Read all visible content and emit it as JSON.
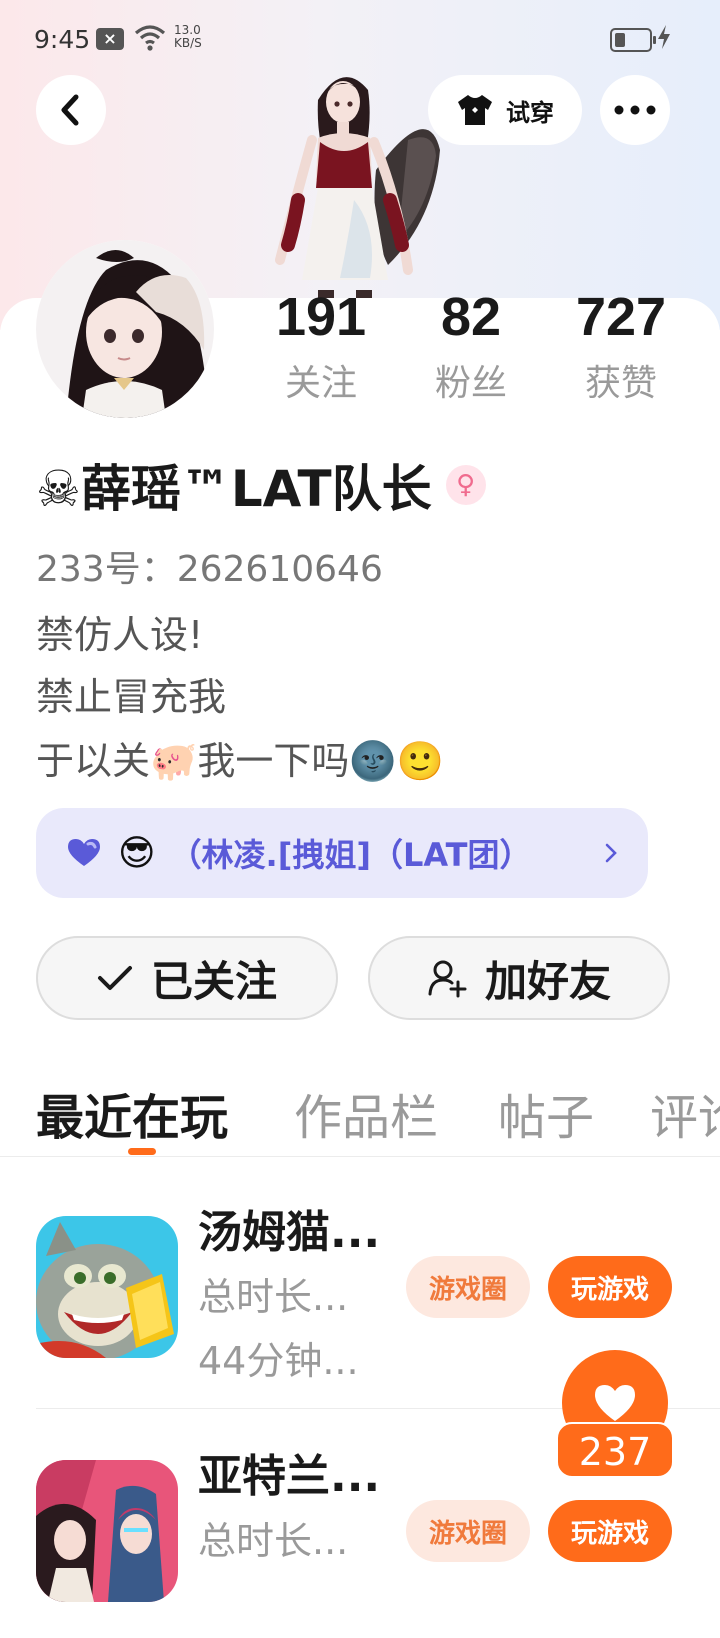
{
  "status_bar": {
    "time": "9:45",
    "net_speed_value": "13.0",
    "net_speed_unit": "KB/S",
    "battery_level": 0.3
  },
  "header": {
    "try_on_label": "试穿"
  },
  "stats": [
    {
      "value": "191",
      "label": "关注"
    },
    {
      "value": "82",
      "label": "粉丝"
    },
    {
      "value": "727",
      "label": "获赞"
    }
  ],
  "profile": {
    "name": "☠薛瑶™LAT队长",
    "gender_symbol": "♀",
    "uid": "233号：262610646",
    "bio": [
      "禁仿人设!",
      "禁止冒充我",
      "于以关🐖我一下吗🌚🙂"
    ]
  },
  "group": {
    "emoji": "😎",
    "label": "（林凌.[拽姐]（LAT团）"
  },
  "actions": {
    "followed_label": "已关注",
    "add_friend_label": "加好友"
  },
  "tabs": [
    {
      "label": "最近在玩",
      "active": true
    },
    {
      "label": "作品栏",
      "active": false
    },
    {
      "label": "帖子",
      "active": false
    },
    {
      "label": "评论",
      "active": false
    }
  ],
  "games": [
    {
      "title": "汤姆猫...",
      "sub1": "总时长...",
      "sub2": "44分钟...",
      "circle_label": "游戏圈",
      "play_label": "玩游戏"
    },
    {
      "title": "亚特兰...",
      "sub1": "总时长...",
      "circle_label": "游戏圈",
      "play_label": "玩游戏"
    }
  ],
  "like": {
    "count": "237"
  },
  "colors": {
    "accent": "#ff6b1a",
    "group_text": "#5a5ad8",
    "group_bg": "#e9e9fb"
  }
}
